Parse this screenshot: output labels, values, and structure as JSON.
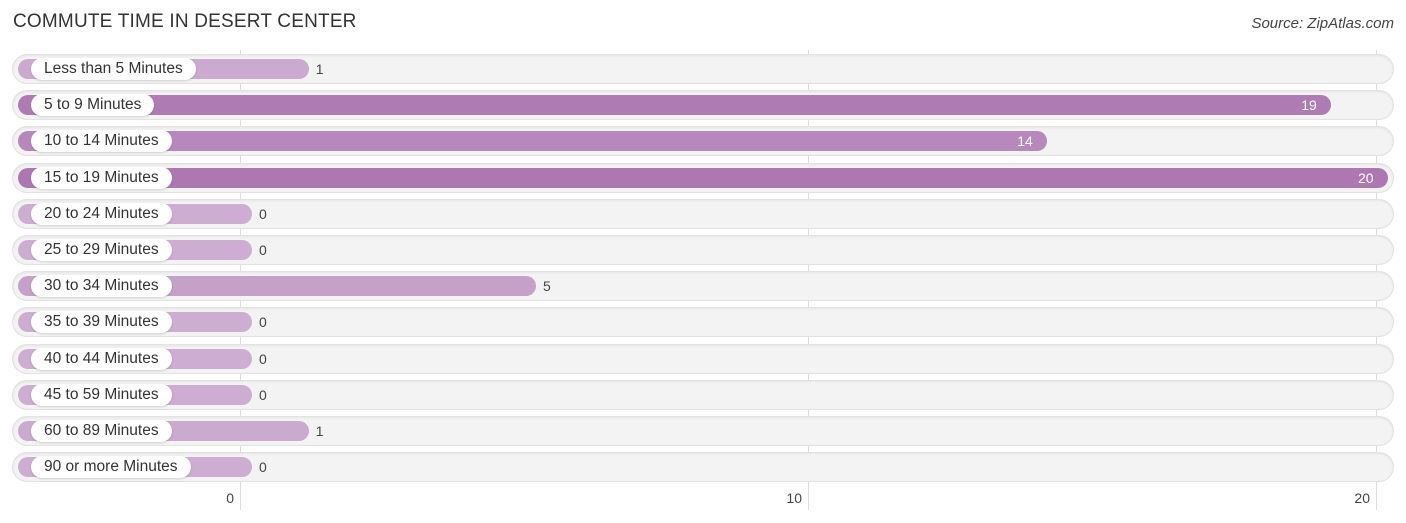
{
  "chart_data": {
    "type": "bar",
    "orientation": "horizontal",
    "title": "COMMUTE TIME IN DESERT CENTER",
    "source": "Source: ZipAtlas.com",
    "categories": [
      "Less than 5 Minutes",
      "5 to 9 Minutes",
      "10 to 14 Minutes",
      "15 to 19 Minutes",
      "20 to 24 Minutes",
      "25 to 29 Minutes",
      "30 to 34 Minutes",
      "35 to 39 Minutes",
      "40 to 44 Minutes",
      "45 to 59 Minutes",
      "60 to 89 Minutes",
      "90 or more Minutes"
    ],
    "values": [
      1,
      19,
      14,
      20,
      0,
      0,
      5,
      0,
      0,
      0,
      1,
      0
    ],
    "xlim": [
      0,
      20
    ],
    "xticks": [
      "0",
      "10",
      "20"
    ],
    "xtick_values": [
      0,
      10,
      20
    ],
    "grid": true,
    "colors": {
      "low": "#cdadd1",
      "high": "#ad78b1"
    }
  }
}
